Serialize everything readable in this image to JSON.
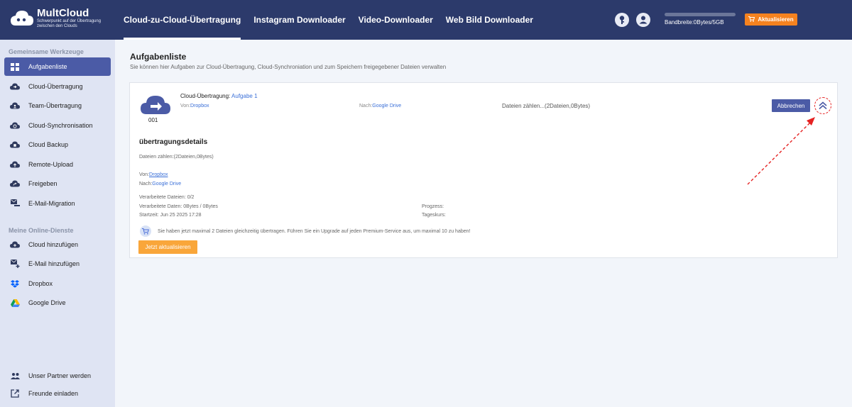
{
  "header": {
    "logo_title": "MultCloud",
    "logo_subtitle": "Schwerpunkt auf der Übertragung zwischen den Clouds",
    "nav": [
      "Cloud-zu-Cloud-Übertragung",
      "Instagram Downloader",
      "Video-Downloader",
      "Web Bild Downloader"
    ],
    "active_nav": 0,
    "bandwidth_text": "Bandbreite:0Bytes/5GB",
    "bandwidth_used_fraction": 0,
    "upgrade_label": "Aktualisieren",
    "icons": [
      "key-icon",
      "user-icon",
      "cart-icon"
    ]
  },
  "sidebar": {
    "section1": "Gemeinsame Werkzeuge",
    "tools": [
      {
        "label": "Aufgabenliste",
        "icon": "grid-icon",
        "active": true
      },
      {
        "label": "Cloud-Übertragung",
        "icon": "cloud-transfer-icon"
      },
      {
        "label": "Team-Übertragung",
        "icon": "team-transfer-icon"
      },
      {
        "label": "Cloud-Synchronisation",
        "icon": "cloud-sync-icon"
      },
      {
        "label": "Cloud Backup",
        "icon": "cloud-backup-icon"
      },
      {
        "label": "Remote-Upload",
        "icon": "remote-upload-icon"
      },
      {
        "label": "Freigeben",
        "icon": "share-icon"
      },
      {
        "label": "E-Mail-Migration",
        "icon": "email-migration-icon"
      }
    ],
    "section2": "Meine Online-Dienste",
    "services": [
      {
        "label": "Cloud hinzufügen",
        "icon": "add-cloud-icon"
      },
      {
        "label": "E-Mail hinzufügen",
        "icon": "add-email-icon"
      },
      {
        "label": "Dropbox",
        "icon": "dropbox-icon"
      },
      {
        "label": "Google Drive",
        "icon": "google-drive-icon"
      }
    ],
    "bottom": [
      {
        "label": "Unser Partner werden",
        "icon": "partner-icon"
      },
      {
        "label": "Freunde einladen",
        "icon": "invite-icon"
      }
    ]
  },
  "main": {
    "title": "Aufgabenliste",
    "subtitle": "Sie können hier Aufgaben zur Cloud-Übertragung, Cloud-Synchroniation und zum Speichern freigegebener Dateien verwalten",
    "task": {
      "number": "001",
      "type_label": "Cloud-Übertragung:",
      "name": "Aufgabe 1",
      "from_label": "Von:",
      "from": "Dropbox",
      "to_label": "Nach:",
      "to": "Google Drive",
      "status": "Dateien zählen...(2Dateien,0Bytes)",
      "cancel_label": "Abbrechen"
    },
    "details": {
      "title": "übertragungsdetails",
      "count": "Dateien zählen:(2Dateien,0Bytes)",
      "from_label": "Von:",
      "from": "Dropbox",
      "to_label": "Nach:",
      "to": "Google Drive",
      "processed_files": "Verarbeitete Dateien: 0/2",
      "processed_data": "Verarbeitete Daten: 0Bytes / 0Bytes",
      "start_time": "Startzeit: Jun 25 2025 17:28",
      "progress": "Progzess:",
      "daily_rate": "Tageskurs:"
    },
    "upgrade_note": "Sie haben jetzt maximal 2 Dateien gleichzeitig übertragen. Führen Sie ein Upgrade auf jeden Premium-Service aus, um maximal 10 zu haben!",
    "upgrade_now_label": "Jetzt aktualisieren"
  },
  "colors": {
    "header_bg": "#2c3a6b",
    "sidebar_bg": "#dfe4f3",
    "active_item": "#4b5ba6",
    "accent_orange": "#f5821f",
    "link": "#3a6fd8",
    "annotation_red": "#e52222"
  }
}
